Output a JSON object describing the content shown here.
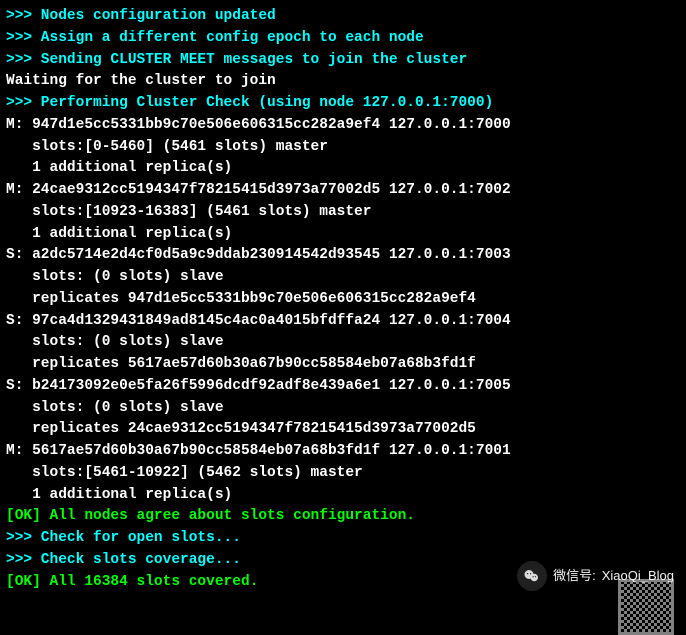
{
  "lines": [
    {
      "cls": "cyan",
      "text": ">>> Nodes configuration updated"
    },
    {
      "cls": "cyan",
      "text": ">>> Assign a different config epoch to each node"
    },
    {
      "cls": "cyan",
      "text": ">>> Sending CLUSTER MEET messages to join the cluster"
    },
    {
      "cls": "white",
      "text": "Waiting for the cluster to join"
    },
    {
      "cls": "white",
      "text": ""
    },
    {
      "cls": "cyan",
      "text": ">>> Performing Cluster Check (using node 127.0.0.1:7000)"
    },
    {
      "cls": "white",
      "text": "M: 947d1e5cc5331bb9c70e506e606315cc282a9ef4 127.0.0.1:7000"
    },
    {
      "cls": "white",
      "text": "   slots:[0-5460] (5461 slots) master"
    },
    {
      "cls": "white",
      "text": "   1 additional replica(s)"
    },
    {
      "cls": "white",
      "text": "M: 24cae9312cc5194347f78215415d3973a77002d5 127.0.0.1:7002"
    },
    {
      "cls": "white",
      "text": "   slots:[10923-16383] (5461 slots) master"
    },
    {
      "cls": "white",
      "text": "   1 additional replica(s)"
    },
    {
      "cls": "white",
      "text": "S: a2dc5714e2d4cf0d5a9c9ddab230914542d93545 127.0.0.1:7003"
    },
    {
      "cls": "white",
      "text": "   slots: (0 slots) slave"
    },
    {
      "cls": "white",
      "text": "   replicates 947d1e5cc5331bb9c70e506e606315cc282a9ef4"
    },
    {
      "cls": "white",
      "text": "S: 97ca4d1329431849ad8145c4ac0a4015bfdffa24 127.0.0.1:7004"
    },
    {
      "cls": "white",
      "text": "   slots: (0 slots) slave"
    },
    {
      "cls": "white",
      "text": "   replicates 5617ae57d60b30a67b90cc58584eb07a68b3fd1f"
    },
    {
      "cls": "white",
      "text": "S: b24173092e0e5fa26f5996dcdf92adf8e439a6e1 127.0.0.1:7005"
    },
    {
      "cls": "white",
      "text": "   slots: (0 slots) slave"
    },
    {
      "cls": "white",
      "text": "   replicates 24cae9312cc5194347f78215415d3973a77002d5"
    },
    {
      "cls": "white",
      "text": "M: 5617ae57d60b30a67b90cc58584eb07a68b3fd1f 127.0.0.1:7001"
    },
    {
      "cls": "white",
      "text": "   slots:[5461-10922] (5462 slots) master"
    },
    {
      "cls": "white",
      "text": "   1 additional replica(s)"
    },
    {
      "cls": "green",
      "text": "[OK] All nodes agree about slots configuration."
    },
    {
      "cls": "cyan",
      "text": ">>> Check for open slots..."
    },
    {
      "cls": "cyan",
      "text": ">>> Check slots coverage..."
    },
    {
      "cls": "green",
      "text": "[OK] All 16384 slots covered."
    }
  ],
  "watermark_label": "微信号:",
  "watermark_id": "XiaoQi_Blog"
}
